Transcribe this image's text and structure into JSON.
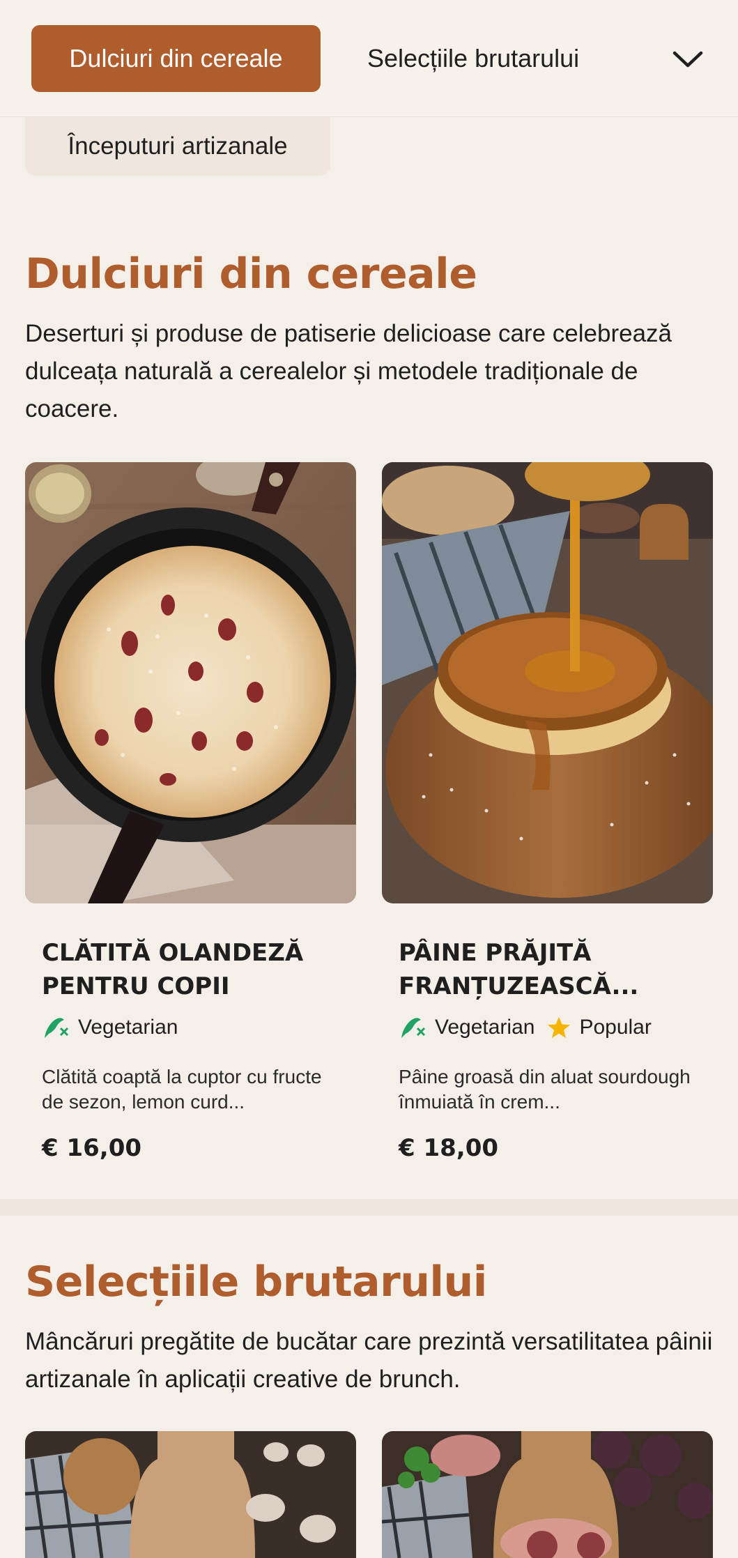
{
  "nav": {
    "active_category": "Dulciuri din cereale",
    "second_category": "Selecțiile brutarului",
    "third_category": "Începuturi artizanale",
    "expand_icon": "chevron-down-icon"
  },
  "sections": [
    {
      "title": "Dulciuri din cereale",
      "description": "Deserturi și produse de patiserie delicioase care celebrează dulceața naturală a cerealelor și metodele tradiționale de coacere.",
      "items": [
        {
          "name": "CLĂTITĂ OLANDEZĂ PENTRU COPII",
          "tags": [
            "Vegetarian"
          ],
          "description": "Clătită coaptă la cuptor cu fructe de sezon, lemon curd...",
          "price": "€ 16,00",
          "image": "skillet-pancake-image"
        },
        {
          "name": "PÂINE PRĂJITĂ FRANȚUZEASCĂ...",
          "tags": [
            "Vegetarian",
            "Popular"
          ],
          "description": "Pâine groasă din aluat sourdough înmuiată în crem...",
          "price": "€ 18,00",
          "image": "french-toast-image"
        }
      ]
    },
    {
      "title": "Selecțiile brutarului",
      "description": "Mâncăruri pregătite de bucătar care prezintă versatilitatea pâinii artizanale în aplicații creative de brunch.",
      "items": [
        {
          "image": "mushroom-board-image"
        },
        {
          "image": "figs-prosciutto-image"
        }
      ]
    }
  ],
  "colors": {
    "accent": "#b05d2e",
    "background": "#f5efea",
    "vegetarian_icon": "#1fa463",
    "popular_icon": "#f4b400"
  }
}
